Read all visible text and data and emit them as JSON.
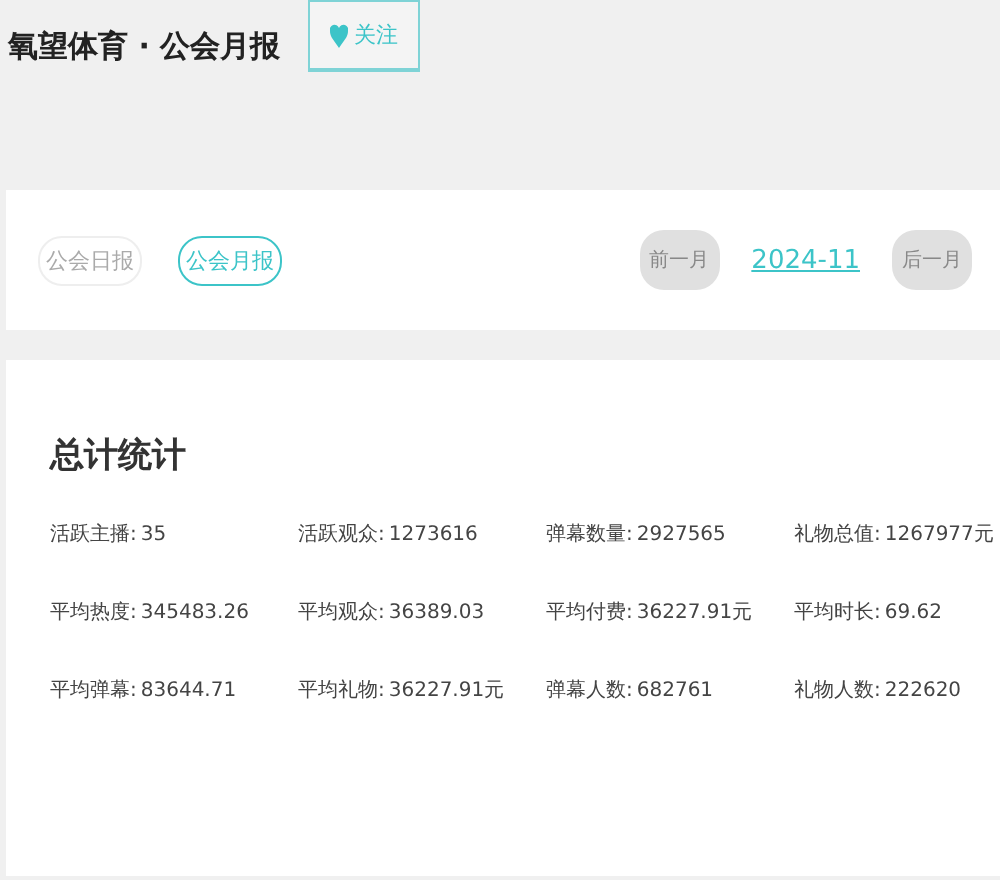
{
  "header": {
    "title": "氧望体育 · 公会月报",
    "follow_button": {
      "label": "关注"
    }
  },
  "tabs": [
    {
      "label": "公会日报",
      "selected": false
    },
    {
      "label": "公会月报",
      "selected": true
    }
  ],
  "month_nav": {
    "prev": "前一月",
    "current": "2024-11",
    "next": "后一月"
  },
  "summary": {
    "title": "总计统计",
    "stats": [
      {
        "label": "活跃主播:",
        "value": "35"
      },
      {
        "label": "活跃观众:",
        "value": "1273616"
      },
      {
        "label": "弹幕数量:",
        "value": "2927565"
      },
      {
        "label": "礼物总值:",
        "value": "1267977元"
      },
      {
        "label": "平均热度:",
        "value": "345483.26"
      },
      {
        "label": "平均观众:",
        "value": "36389.03"
      },
      {
        "label": "平均付费:",
        "value": "36227.91元"
      },
      {
        "label": "平均时长:",
        "value": "69.62"
      },
      {
        "label": "平均弹幕:",
        "value": "83644.71"
      },
      {
        "label": "平均礼物:",
        "value": "36227.91元"
      },
      {
        "label": "弹幕人数:",
        "value": "682761"
      },
      {
        "label": "礼物人数:",
        "value": "222620"
      }
    ]
  }
}
